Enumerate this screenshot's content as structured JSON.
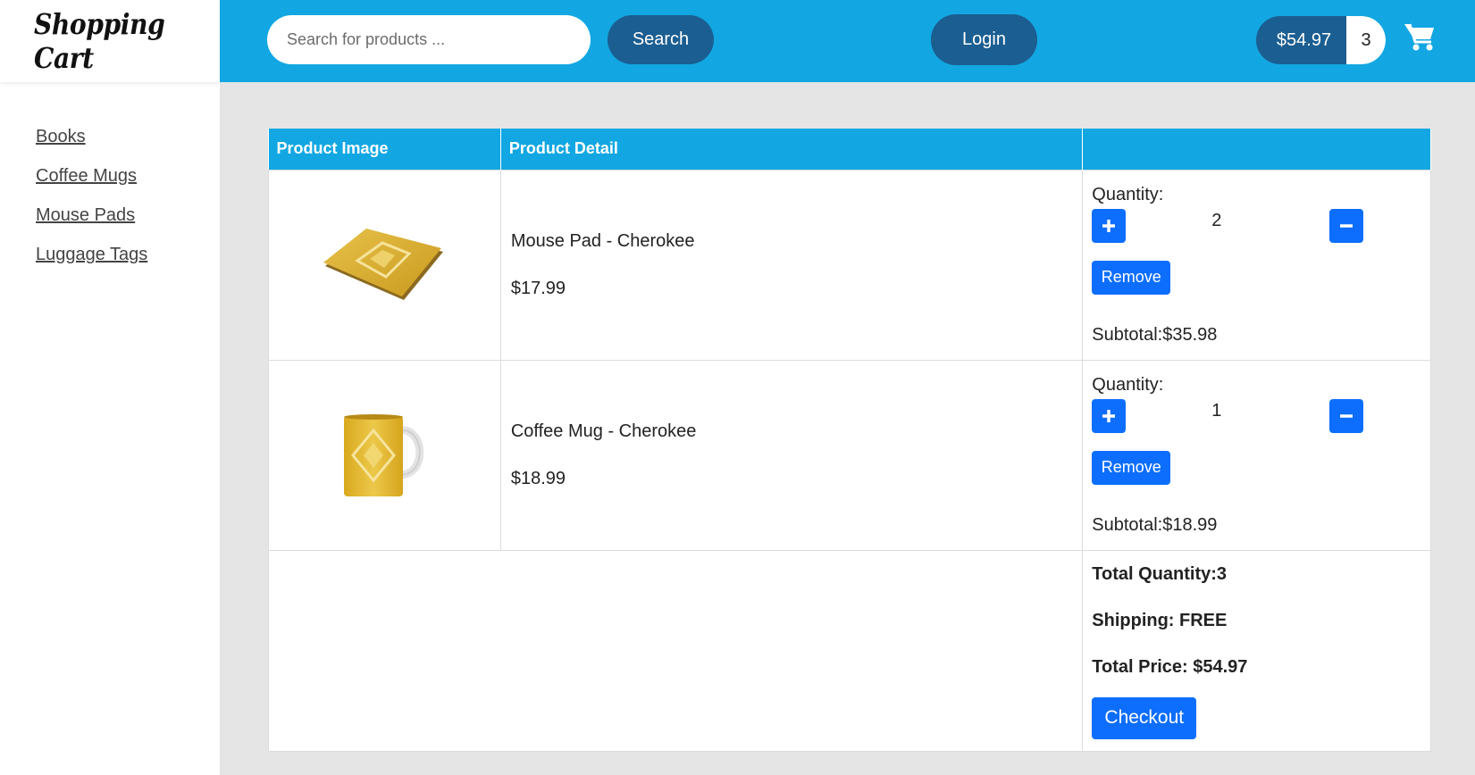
{
  "brand": {
    "logo_text": "Shopping Cart"
  },
  "sidebar": {
    "items": [
      {
        "label": "Books"
      },
      {
        "label": "Coffee Mugs"
      },
      {
        "label": "Mouse Pads"
      },
      {
        "label": "Luggage Tags"
      }
    ]
  },
  "header": {
    "search_placeholder": "Search for products ...",
    "search_label": "Search",
    "login_label": "Login",
    "cart_total": "$54.97",
    "cart_count": "3",
    "cart_icon": "shopping-cart-icon"
  },
  "table": {
    "headers": [
      "Product Image",
      "Product Detail",
      ""
    ],
    "rows": [
      {
        "name": "Mouse Pad - Cherokee",
        "price": "$17.99",
        "quantity_label": "Quantity:",
        "quantity": "2",
        "remove_label": "Remove",
        "subtotal": "Subtotal:$35.98",
        "image": "mouse-pad-image"
      },
      {
        "name": "Coffee Mug - Cherokee",
        "price": "$18.99",
        "quantity_label": "Quantity:",
        "quantity": "1",
        "remove_label": "Remove",
        "subtotal": "Subtotal:$18.99",
        "image": "coffee-mug-image"
      }
    ]
  },
  "summary": {
    "total_quantity": "Total Quantity:3",
    "shipping": "Shipping: FREE",
    "total_price": "Total Price: $54.97",
    "checkout_label": "Checkout"
  },
  "colors": {
    "header_bg": "#12a7e2",
    "dark_pill": "#1b5e91",
    "primary_button": "#0d6efd",
    "page_bg": "#e5e5e5"
  }
}
